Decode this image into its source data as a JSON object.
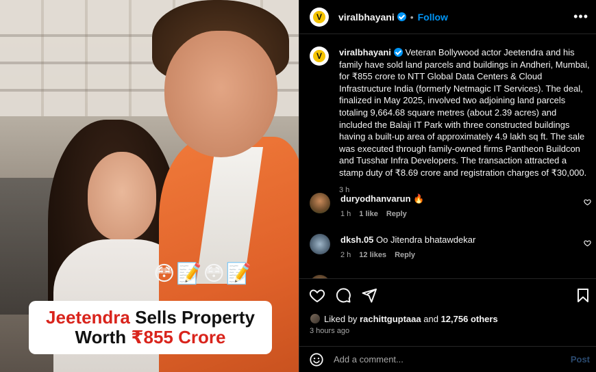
{
  "header": {
    "username": "viralbhayani",
    "avatar_letter": "V",
    "separator": "•",
    "follow_label": "Follow",
    "more_label": "•••"
  },
  "media": {
    "emoji_overlay": "😳📝😳📝",
    "caption_name": "Jeetendra",
    "caption_rest_line1": " Sells Property",
    "caption_line2_prefix": "Worth ",
    "caption_amount": "₹855 Crore"
  },
  "caption": {
    "username": "viralbhayani",
    "text": "Veteran Bollywood actor Jeetendra and his family have sold land parcels and buildings in Andheri, Mumbai, for ₹855 crore to NTT Global Data Centers & Cloud Infrastructure India (formerly Netmagic IT Services). The deal, finalized in May 2025, involved two adjoining land parcels totaling 9,664.68 square metres (about 2.39 acres) and included the Balaji IT Park with three constructed buildings having a built-up area of approximately 4.9 lakh sq ft. The sale was executed through family-owned firms Pantheon Buildcon and Tusshar Infra Developers. The transaction attracted a stamp duty of ₹8.69 crore and registration charges of ₹30,000.",
    "time": "3 h"
  },
  "comments": [
    {
      "username": "duryodhanvarun",
      "text": "🔥",
      "time": "1 h",
      "likes": "1 like",
      "reply": "Reply"
    },
    {
      "username": "dksh.05",
      "text": "Oo Jitendra bhatawdekar",
      "time": "2 h",
      "likes": "12 likes",
      "reply": "Reply"
    }
  ],
  "likes": {
    "prefix": "Liked by ",
    "user": "rachittguptaaa",
    "middle": " and ",
    "count": "12,756 others"
  },
  "post_time": "3 hours ago",
  "add_comment": {
    "placeholder": "Add a comment...",
    "post_label": "Post"
  },
  "colors": {
    "accent": "#0095f6",
    "caption_red": "#d9241c",
    "jacket": "#e0622a"
  }
}
